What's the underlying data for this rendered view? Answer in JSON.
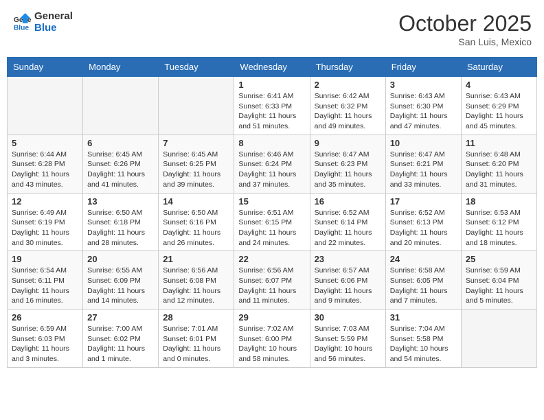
{
  "header": {
    "logo_line1": "General",
    "logo_line2": "Blue",
    "month": "October 2025",
    "location": "San Luis, Mexico"
  },
  "days_of_week": [
    "Sunday",
    "Monday",
    "Tuesday",
    "Wednesday",
    "Thursday",
    "Friday",
    "Saturday"
  ],
  "weeks": [
    [
      {
        "day": "",
        "info": ""
      },
      {
        "day": "",
        "info": ""
      },
      {
        "day": "",
        "info": ""
      },
      {
        "day": "1",
        "info": "Sunrise: 6:41 AM\nSunset: 6:33 PM\nDaylight: 11 hours\nand 51 minutes."
      },
      {
        "day": "2",
        "info": "Sunrise: 6:42 AM\nSunset: 6:32 PM\nDaylight: 11 hours\nand 49 minutes."
      },
      {
        "day": "3",
        "info": "Sunrise: 6:43 AM\nSunset: 6:30 PM\nDaylight: 11 hours\nand 47 minutes."
      },
      {
        "day": "4",
        "info": "Sunrise: 6:43 AM\nSunset: 6:29 PM\nDaylight: 11 hours\nand 45 minutes."
      }
    ],
    [
      {
        "day": "5",
        "info": "Sunrise: 6:44 AM\nSunset: 6:28 PM\nDaylight: 11 hours\nand 43 minutes."
      },
      {
        "day": "6",
        "info": "Sunrise: 6:45 AM\nSunset: 6:26 PM\nDaylight: 11 hours\nand 41 minutes."
      },
      {
        "day": "7",
        "info": "Sunrise: 6:45 AM\nSunset: 6:25 PM\nDaylight: 11 hours\nand 39 minutes."
      },
      {
        "day": "8",
        "info": "Sunrise: 6:46 AM\nSunset: 6:24 PM\nDaylight: 11 hours\nand 37 minutes."
      },
      {
        "day": "9",
        "info": "Sunrise: 6:47 AM\nSunset: 6:23 PM\nDaylight: 11 hours\nand 35 minutes."
      },
      {
        "day": "10",
        "info": "Sunrise: 6:47 AM\nSunset: 6:21 PM\nDaylight: 11 hours\nand 33 minutes."
      },
      {
        "day": "11",
        "info": "Sunrise: 6:48 AM\nSunset: 6:20 PM\nDaylight: 11 hours\nand 31 minutes."
      }
    ],
    [
      {
        "day": "12",
        "info": "Sunrise: 6:49 AM\nSunset: 6:19 PM\nDaylight: 11 hours\nand 30 minutes."
      },
      {
        "day": "13",
        "info": "Sunrise: 6:50 AM\nSunset: 6:18 PM\nDaylight: 11 hours\nand 28 minutes."
      },
      {
        "day": "14",
        "info": "Sunrise: 6:50 AM\nSunset: 6:16 PM\nDaylight: 11 hours\nand 26 minutes."
      },
      {
        "day": "15",
        "info": "Sunrise: 6:51 AM\nSunset: 6:15 PM\nDaylight: 11 hours\nand 24 minutes."
      },
      {
        "day": "16",
        "info": "Sunrise: 6:52 AM\nSunset: 6:14 PM\nDaylight: 11 hours\nand 22 minutes."
      },
      {
        "day": "17",
        "info": "Sunrise: 6:52 AM\nSunset: 6:13 PM\nDaylight: 11 hours\nand 20 minutes."
      },
      {
        "day": "18",
        "info": "Sunrise: 6:53 AM\nSunset: 6:12 PM\nDaylight: 11 hours\nand 18 minutes."
      }
    ],
    [
      {
        "day": "19",
        "info": "Sunrise: 6:54 AM\nSunset: 6:11 PM\nDaylight: 11 hours\nand 16 minutes."
      },
      {
        "day": "20",
        "info": "Sunrise: 6:55 AM\nSunset: 6:09 PM\nDaylight: 11 hours\nand 14 minutes."
      },
      {
        "day": "21",
        "info": "Sunrise: 6:56 AM\nSunset: 6:08 PM\nDaylight: 11 hours\nand 12 minutes."
      },
      {
        "day": "22",
        "info": "Sunrise: 6:56 AM\nSunset: 6:07 PM\nDaylight: 11 hours\nand 11 minutes."
      },
      {
        "day": "23",
        "info": "Sunrise: 6:57 AM\nSunset: 6:06 PM\nDaylight: 11 hours\nand 9 minutes."
      },
      {
        "day": "24",
        "info": "Sunrise: 6:58 AM\nSunset: 6:05 PM\nDaylight: 11 hours\nand 7 minutes."
      },
      {
        "day": "25",
        "info": "Sunrise: 6:59 AM\nSunset: 6:04 PM\nDaylight: 11 hours\nand 5 minutes."
      }
    ],
    [
      {
        "day": "26",
        "info": "Sunrise: 6:59 AM\nSunset: 6:03 PM\nDaylight: 11 hours\nand 3 minutes."
      },
      {
        "day": "27",
        "info": "Sunrise: 7:00 AM\nSunset: 6:02 PM\nDaylight: 11 hours\nand 1 minute."
      },
      {
        "day": "28",
        "info": "Sunrise: 7:01 AM\nSunset: 6:01 PM\nDaylight: 11 hours\nand 0 minutes."
      },
      {
        "day": "29",
        "info": "Sunrise: 7:02 AM\nSunset: 6:00 PM\nDaylight: 10 hours\nand 58 minutes."
      },
      {
        "day": "30",
        "info": "Sunrise: 7:03 AM\nSunset: 5:59 PM\nDaylight: 10 hours\nand 56 minutes."
      },
      {
        "day": "31",
        "info": "Sunrise: 7:04 AM\nSunset: 5:58 PM\nDaylight: 10 hours\nand 54 minutes."
      },
      {
        "day": "",
        "info": ""
      }
    ]
  ]
}
